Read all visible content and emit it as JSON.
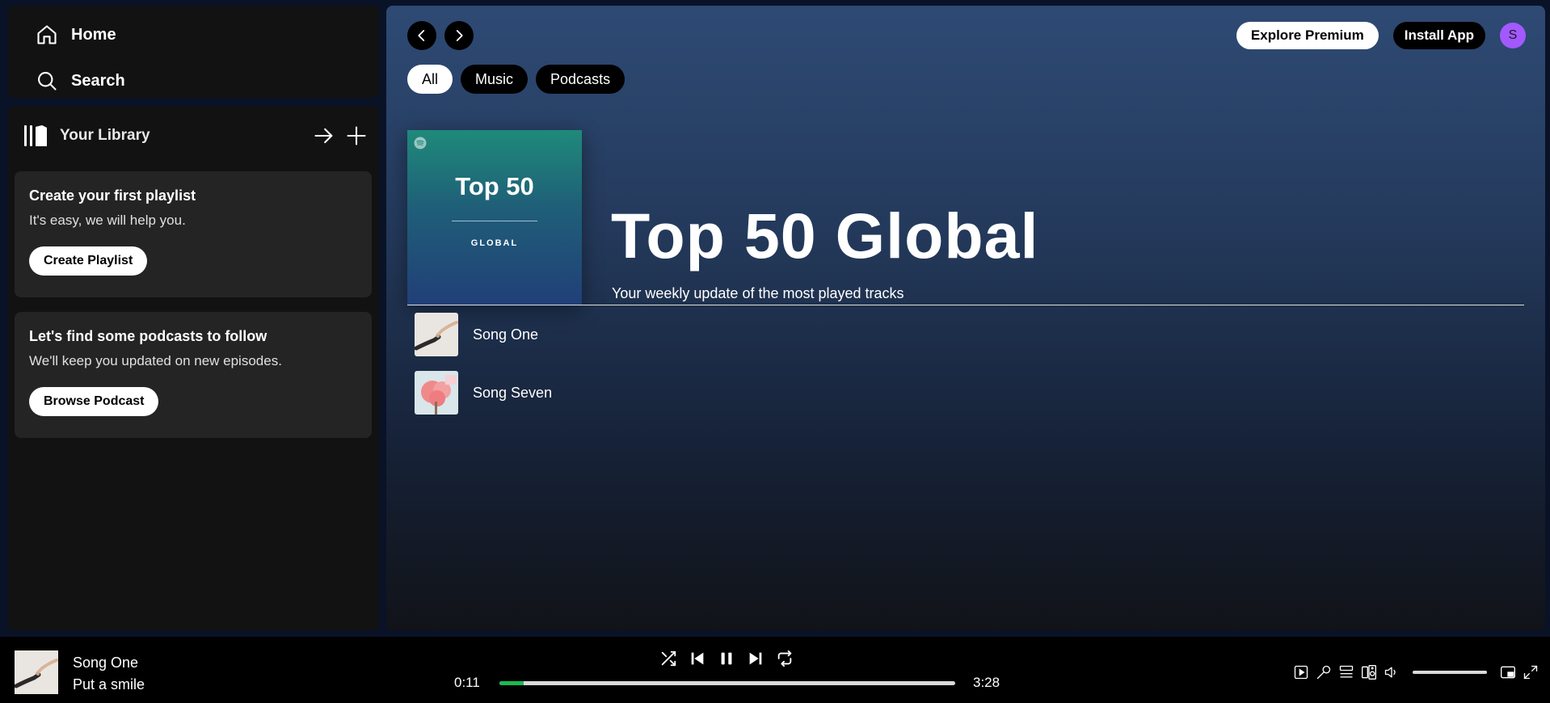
{
  "sidebar": {
    "nav": {
      "home_label": "Home",
      "search_label": "Search"
    },
    "library": {
      "title": "Your Library",
      "cards": [
        {
          "title": "Create your first playlist",
          "subtitle": "It's easy, we will help you.",
          "button": "Create Playlist"
        },
        {
          "title": "Let's find some podcasts to follow",
          "subtitle": "We'll keep you updated on new episodes.",
          "button": "Browse Podcast"
        }
      ]
    }
  },
  "header": {
    "explore_premium": "Explore Premium",
    "install_app": "Install App",
    "avatar_initial": "S"
  },
  "filters": [
    "All",
    "Music",
    "Podcasts"
  ],
  "playlist": {
    "cover_title": "Top 50",
    "cover_subtitle": "GLOBAL",
    "title": "Top 50 Global",
    "description": "Your weekly update of the most played tracks",
    "tracks": [
      {
        "name": "Song One"
      },
      {
        "name": "Song Seven"
      }
    ]
  },
  "player": {
    "track_title": "Song One",
    "track_artist": "Put a smile",
    "time_current": "0:11",
    "time_total": "3:28",
    "progress_fraction": 0.053,
    "volume_fraction": 1.0
  },
  "colors": {
    "accent_green": "#1db954",
    "avatar_bg": "#a259ff",
    "sidebar_bg": "#121212",
    "card_bg": "#242424"
  }
}
